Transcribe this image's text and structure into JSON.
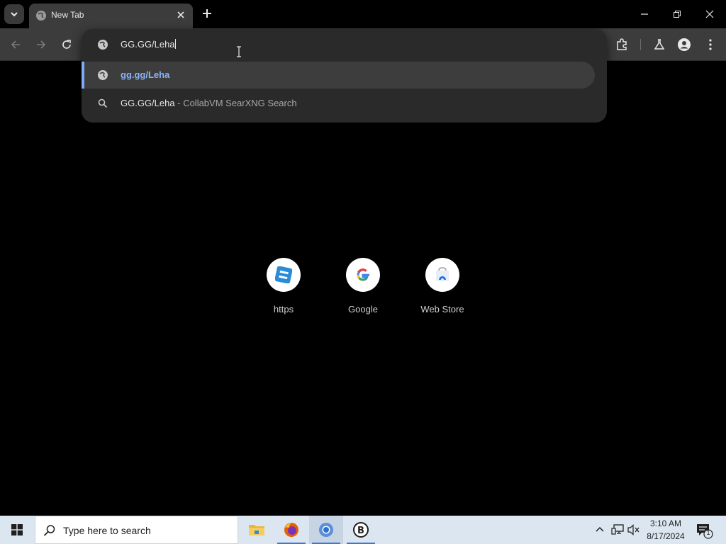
{
  "browser": {
    "tab": {
      "title": "New Tab"
    },
    "omnibox": {
      "typed_text": "GG.GG/Leha",
      "suggestions": [
        {
          "type": "url",
          "text": "gg.gg/Leha",
          "selected": true
        },
        {
          "type": "search",
          "query": "GG.GG/Leha",
          "separator": "-",
          "engine": "CollabVM SearXNG Search",
          "selected": false
        }
      ]
    }
  },
  "shortcuts": [
    {
      "label": "https",
      "icon": "https-app-icon"
    },
    {
      "label": "Google",
      "icon": "google-icon"
    },
    {
      "label": "Web Store",
      "icon": "web-store-icon"
    }
  ],
  "taskbar": {
    "search_placeholder": "Type here to search",
    "apps": [
      {
        "name": "File Explorer",
        "icon": "folder-icon"
      },
      {
        "name": "Firefox",
        "icon": "firefox-icon"
      },
      {
        "name": "Chromium",
        "icon": "chromium-icon"
      },
      {
        "name": "B",
        "icon": "b-app-icon"
      }
    ],
    "clock": {
      "time": "3:10 AM",
      "date": "8/17/2024"
    },
    "notification_count": "1"
  },
  "colors": {
    "accent": "#7cacf8",
    "url_suggestion": "#8ab4f8",
    "toolbar": "#3c3c3c",
    "page_background": "#000000",
    "taskbar": "#dbe6f1"
  }
}
